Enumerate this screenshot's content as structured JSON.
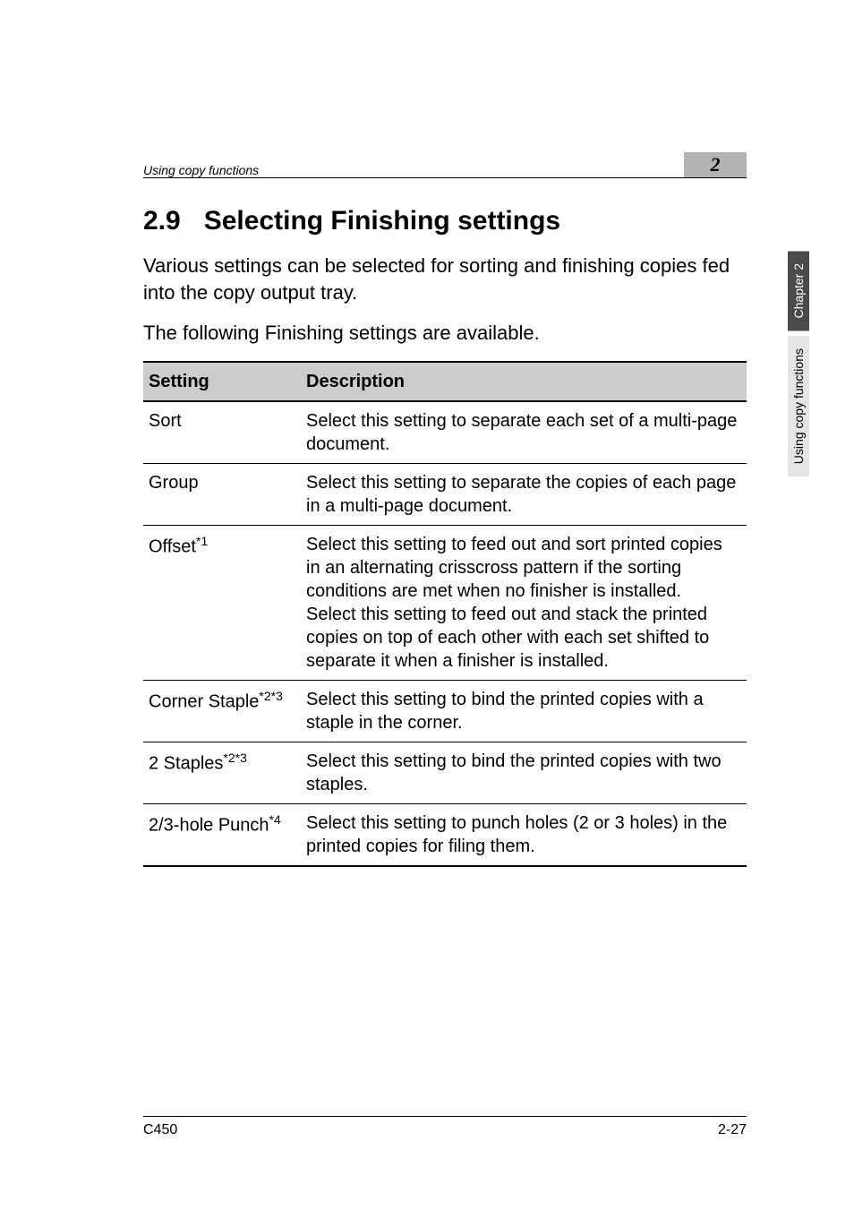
{
  "header": {
    "running_title": "Using copy functions",
    "chapter_number": "2"
  },
  "section": {
    "number": "2.9",
    "title": "Selecting Finishing settings"
  },
  "intro": {
    "p1": "Various settings can be selected for sorting and finishing copies fed into the copy output tray.",
    "p2": "The following Finishing settings are available."
  },
  "table": {
    "head": {
      "c1": "Setting",
      "c2": "Description"
    },
    "rows": [
      {
        "setting_html": "Sort",
        "desc": "Select this setting to separate each set of a multi-page document."
      },
      {
        "setting_html": "Group",
        "desc": "Select this setting to separate the copies of each page in a multi-page document."
      },
      {
        "setting_html": "Offset<sup>*1</sup>",
        "desc": "Select this setting to feed out and sort printed copies in an alternating crisscross pattern if the sorting conditions are met when no finisher is installed.\nSelect this setting to feed out and stack the printed copies on top of each other with each set shifted to separate it when a finisher is installed."
      },
      {
        "setting_html": "Corner Staple<sup>*2*3</sup>",
        "desc": "Select this setting to bind the printed copies with a staple in the corner."
      },
      {
        "setting_html": "2 Staples<sup>*2*3</sup>",
        "desc": "Select this setting to bind the printed copies with two staples."
      },
      {
        "setting_html": "2/3-hole Punch<sup>*4</sup>",
        "desc": "Select this setting to punch holes (2 or 3 holes) in the printed copies for filing them."
      }
    ]
  },
  "side_tabs": {
    "dark": "Chapter 2",
    "light": "Using copy functions"
  },
  "footer": {
    "left": "C450",
    "right": "2-27"
  }
}
